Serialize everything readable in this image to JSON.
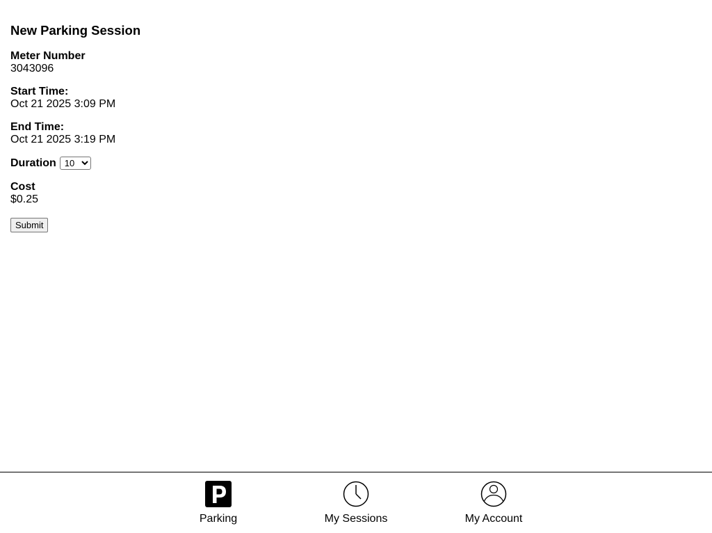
{
  "main": {
    "title": "New Parking Session",
    "meter": {
      "label": "Meter Number",
      "value": "3043096"
    },
    "start_time": {
      "label": "Start Time:",
      "value": "Oct 21 2025 3:09 PM"
    },
    "end_time": {
      "label": "End Time:",
      "value": "Oct 21 2025 3:19 PM"
    },
    "duration": {
      "label": "Duration",
      "selected": "10"
    },
    "cost": {
      "label": "Cost",
      "value": "$0.25"
    },
    "submit_label": "Submit"
  },
  "nav": {
    "items": [
      {
        "label": "Parking",
        "icon": "parking-icon"
      },
      {
        "label": "My Sessions",
        "icon": "clock-icon"
      },
      {
        "label": "My Account",
        "icon": "user-icon"
      }
    ]
  }
}
